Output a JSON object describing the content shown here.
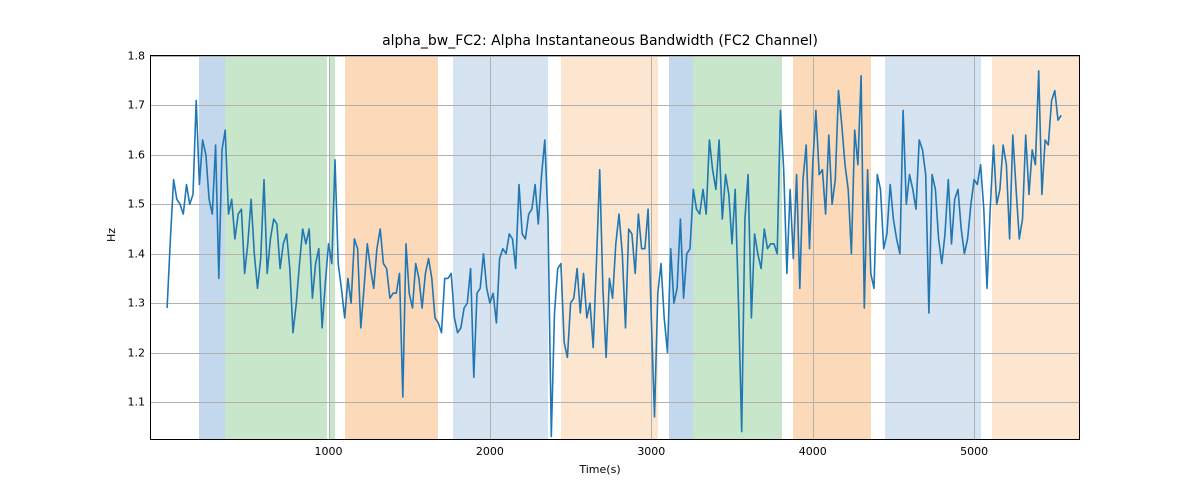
{
  "chart_data": {
    "type": "line",
    "title": "alpha_bw_FC2: Alpha Instantaneous Bandwidth (FC2 Channel)",
    "xlabel": "Time(s)",
    "ylabel": "Hz",
    "xlim": [
      -100,
      5650
    ],
    "ylim": [
      1.025,
      1.8
    ],
    "yticks": [
      1.1,
      1.2,
      1.3,
      1.4,
      1.5,
      1.6,
      1.7,
      1.8
    ],
    "xticks": [
      1000,
      2000,
      3000,
      4000,
      5000
    ],
    "bands": [
      {
        "x0": 200,
        "x1": 360,
        "color": "#c3d8ec"
      },
      {
        "x0": 360,
        "x1": 990,
        "color": "#c8e6c9"
      },
      {
        "x0": 1000,
        "x1": 1040,
        "color": "#c8e6c9"
      },
      {
        "x0": 1100,
        "x1": 1680,
        "color": "#fcd9b8"
      },
      {
        "x0": 1770,
        "x1": 2360,
        "color": "#d6e3f0"
      },
      {
        "x0": 2440,
        "x1": 3040,
        "color": "#fde6cf"
      },
      {
        "x0": 3110,
        "x1": 3260,
        "color": "#c3d8ec"
      },
      {
        "x0": 3260,
        "x1": 3810,
        "color": "#c8e6c9"
      },
      {
        "x0": 3880,
        "x1": 4360,
        "color": "#fcd9b8"
      },
      {
        "x0": 4450,
        "x1": 5040,
        "color": "#d6e3f0"
      },
      {
        "x0": 5110,
        "x1": 5650,
        "color": "#fde6cf"
      }
    ],
    "x": [
      0,
      20,
      40,
      60,
      80,
      100,
      120,
      140,
      160,
      180,
      200,
      220,
      240,
      260,
      280,
      300,
      320,
      340,
      360,
      380,
      400,
      420,
      440,
      460,
      480,
      500,
      520,
      540,
      560,
      580,
      600,
      620,
      640,
      660,
      680,
      700,
      720,
      740,
      760,
      780,
      800,
      820,
      840,
      860,
      880,
      900,
      920,
      940,
      960,
      980,
      1000,
      1020,
      1040,
      1060,
      1080,
      1100,
      1120,
      1140,
      1160,
      1180,
      1200,
      1220,
      1240,
      1260,
      1280,
      1300,
      1320,
      1340,
      1360,
      1380,
      1400,
      1420,
      1440,
      1460,
      1480,
      1500,
      1520,
      1540,
      1560,
      1580,
      1600,
      1620,
      1640,
      1660,
      1680,
      1700,
      1720,
      1740,
      1760,
      1780,
      1800,
      1820,
      1840,
      1860,
      1880,
      1900,
      1920,
      1940,
      1960,
      1980,
      2000,
      2020,
      2040,
      2060,
      2080,
      2100,
      2120,
      2140,
      2160,
      2180,
      2200,
      2220,
      2240,
      2260,
      2280,
      2300,
      2320,
      2340,
      2360,
      2380,
      2400,
      2420,
      2440,
      2460,
      2480,
      2500,
      2520,
      2540,
      2560,
      2580,
      2600,
      2620,
      2640,
      2660,
      2680,
      2700,
      2720,
      2740,
      2760,
      2780,
      2800,
      2820,
      2840,
      2860,
      2880,
      2900,
      2920,
      2940,
      2960,
      2980,
      3000,
      3020,
      3040,
      3060,
      3080,
      3100,
      3120,
      3140,
      3160,
      3180,
      3200,
      3220,
      3240,
      3260,
      3280,
      3300,
      3320,
      3340,
      3360,
      3380,
      3400,
      3420,
      3440,
      3460,
      3480,
      3500,
      3520,
      3540,
      3560,
      3580,
      3600,
      3620,
      3640,
      3660,
      3680,
      3700,
      3720,
      3740,
      3760,
      3780,
      3800,
      3820,
      3840,
      3860,
      3880,
      3900,
      3920,
      3940,
      3960,
      3980,
      4000,
      4020,
      4040,
      4060,
      4080,
      4100,
      4120,
      4140,
      4160,
      4180,
      4200,
      4220,
      4240,
      4260,
      4280,
      4300,
      4320,
      4340,
      4360,
      4380,
      4400,
      4420,
      4440,
      4460,
      4480,
      4500,
      4520,
      4540,
      4560,
      4580,
      4600,
      4620,
      4640,
      4660,
      4680,
      4700,
      4720,
      4740,
      4760,
      4780,
      4800,
      4820,
      4840,
      4860,
      4880,
      4900,
      4920,
      4940,
      4960,
      4980,
      5000,
      5020,
      5040,
      5060,
      5080,
      5100,
      5120,
      5140,
      5160,
      5180,
      5200,
      5220,
      5240,
      5260,
      5280,
      5300,
      5320,
      5340,
      5360,
      5380,
      5400,
      5420,
      5440,
      5460,
      5480,
      5500,
      5520,
      5540
    ],
    "y": [
      1.29,
      1.43,
      1.55,
      1.51,
      1.5,
      1.48,
      1.54,
      1.5,
      1.52,
      1.71,
      1.54,
      1.63,
      1.6,
      1.51,
      1.48,
      1.62,
      1.35,
      1.61,
      1.65,
      1.48,
      1.51,
      1.43,
      1.48,
      1.49,
      1.36,
      1.42,
      1.51,
      1.4,
      1.33,
      1.39,
      1.55,
      1.36,
      1.43,
      1.47,
      1.46,
      1.37,
      1.42,
      1.44,
      1.37,
      1.24,
      1.3,
      1.38,
      1.45,
      1.42,
      1.45,
      1.31,
      1.38,
      1.41,
      1.25,
      1.34,
      1.42,
      1.38,
      1.59,
      1.38,
      1.33,
      1.27,
      1.35,
      1.3,
      1.43,
      1.41,
      1.25,
      1.33,
      1.42,
      1.37,
      1.33,
      1.41,
      1.45,
      1.38,
      1.37,
      1.31,
      1.32,
      1.32,
      1.36,
      1.11,
      1.42,
      1.32,
      1.29,
      1.38,
      1.35,
      1.29,
      1.36,
      1.39,
      1.35,
      1.27,
      1.26,
      1.24,
      1.35,
      1.35,
      1.36,
      1.27,
      1.24,
      1.25,
      1.29,
      1.3,
      1.37,
      1.15,
      1.32,
      1.33,
      1.4,
      1.33,
      1.3,
      1.32,
      1.26,
      1.39,
      1.41,
      1.4,
      1.44,
      1.43,
      1.37,
      1.54,
      1.44,
      1.43,
      1.48,
      1.49,
      1.54,
      1.46,
      1.56,
      1.63,
      1.47,
      1.03,
      1.28,
      1.37,
      1.38,
      1.22,
      1.19,
      1.3,
      1.31,
      1.37,
      1.28,
      1.36,
      1.27,
      1.3,
      1.21,
      1.38,
      1.57,
      1.33,
      1.19,
      1.35,
      1.31,
      1.42,
      1.48,
      1.4,
      1.25,
      1.45,
      1.44,
      1.36,
      1.48,
      1.41,
      1.41,
      1.49,
      1.27,
      1.07,
      1.32,
      1.38,
      1.27,
      1.2,
      1.41,
      1.3,
      1.33,
      1.47,
      1.31,
      1.4,
      1.41,
      1.53,
      1.49,
      1.48,
      1.53,
      1.48,
      1.63,
      1.57,
      1.53,
      1.63,
      1.47,
      1.56,
      1.52,
      1.42,
      1.53,
      1.3,
      1.04,
      1.47,
      1.56,
      1.27,
      1.44,
      1.4,
      1.37,
      1.45,
      1.41,
      1.42,
      1.42,
      1.4,
      1.69,
      1.57,
      1.36,
      1.53,
      1.39,
      1.56,
      1.33,
      1.55,
      1.62,
      1.41,
      1.58,
      1.69,
      1.56,
      1.57,
      1.48,
      1.64,
      1.5,
      1.55,
      1.73,
      1.66,
      1.58,
      1.53,
      1.4,
      1.65,
      1.58,
      1.76,
      1.29,
      1.57,
      1.36,
      1.33,
      1.56,
      1.53,
      1.41,
      1.44,
      1.54,
      1.47,
      1.43,
      1.4,
      1.69,
      1.5,
      1.56,
      1.53,
      1.49,
      1.63,
      1.61,
      1.56,
      1.28,
      1.56,
      1.53,
      1.43,
      1.38,
      1.44,
      1.55,
      1.42,
      1.51,
      1.53,
      1.45,
      1.4,
      1.43,
      1.5,
      1.55,
      1.54,
      1.58,
      1.49,
      1.33,
      1.49,
      1.62,
      1.5,
      1.53,
      1.62,
      1.58,
      1.43,
      1.64,
      1.53,
      1.43,
      1.47,
      1.64,
      1.52,
      1.61,
      1.58,
      1.77,
      1.52,
      1.63,
      1.62,
      1.71,
      1.73,
      1.67,
      1.68
    ]
  }
}
